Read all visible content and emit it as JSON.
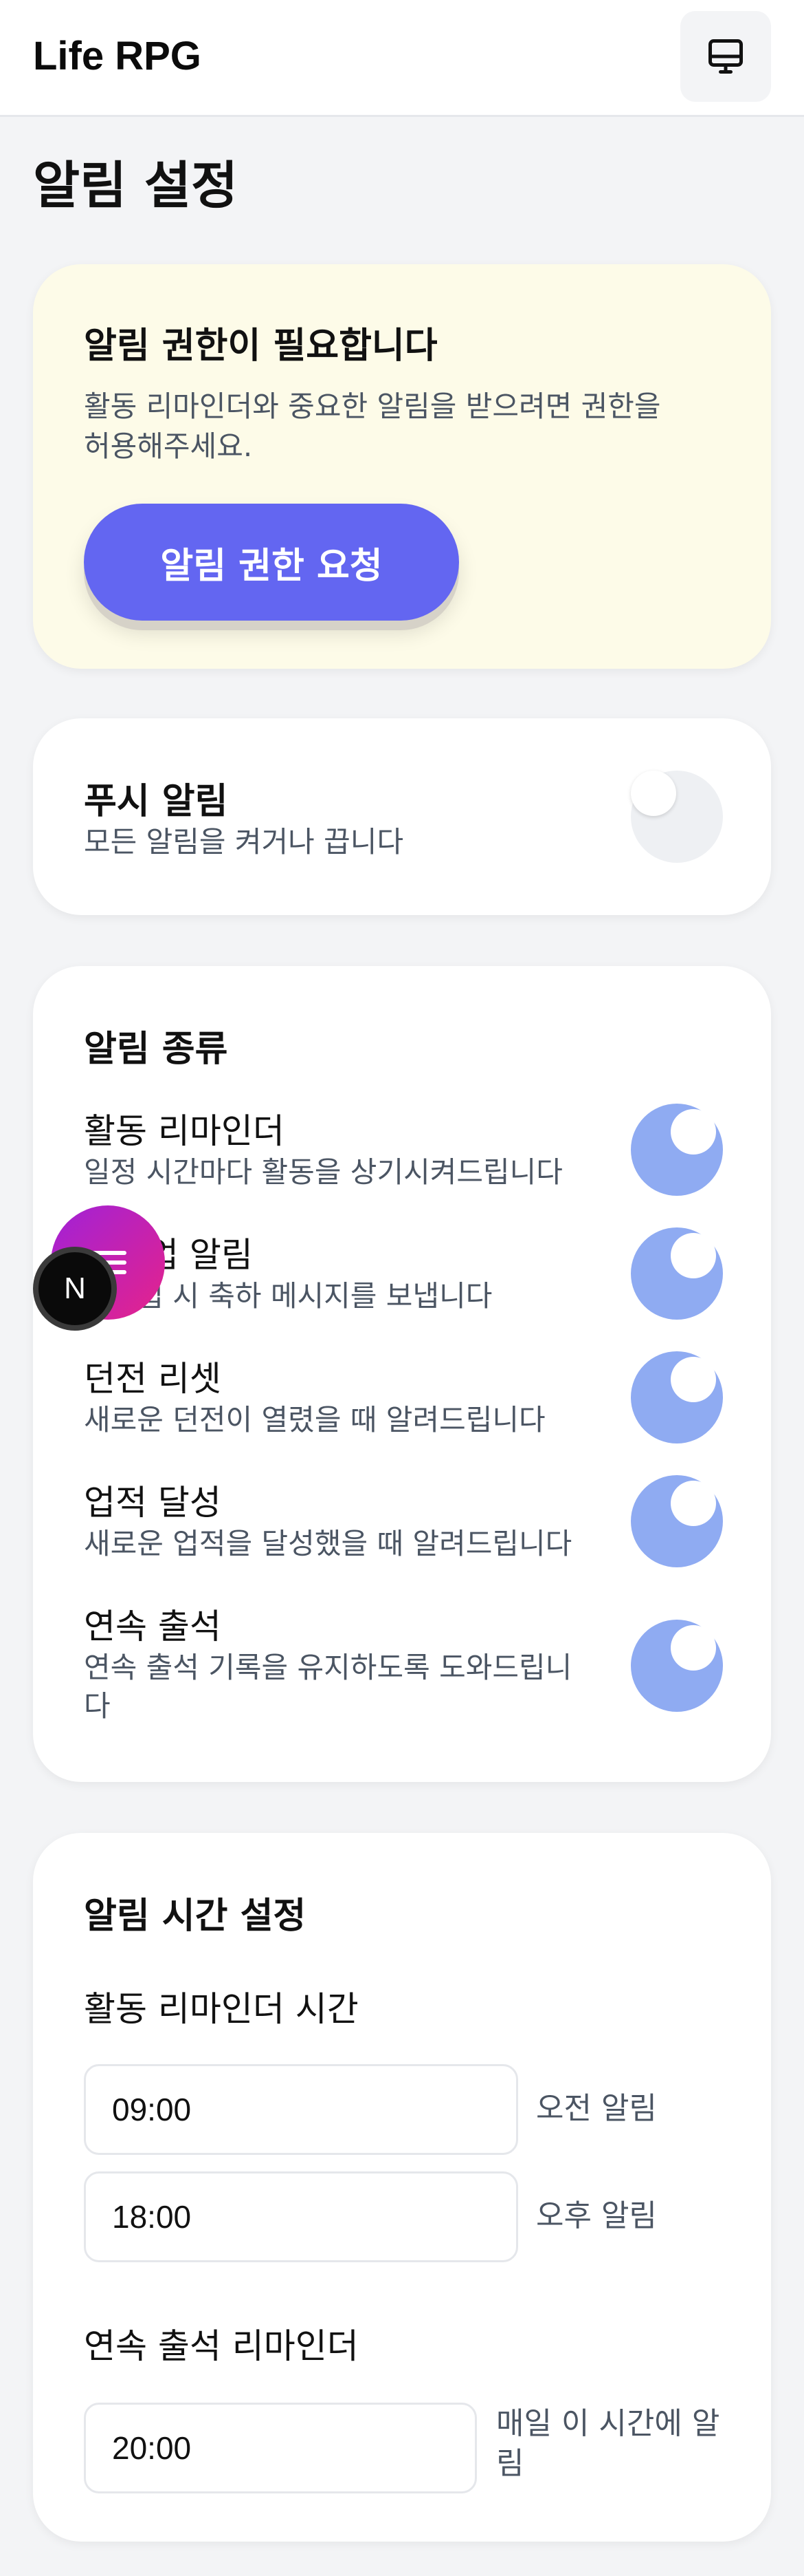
{
  "header": {
    "app_title": "Life RPG",
    "icon": "monitor-icon"
  },
  "page": {
    "title": "알림 설정"
  },
  "permission": {
    "title": "알림 권한이 필요합니다",
    "description_line1": "활동 리마인더와 중요한 알림을 받으려면 권한을",
    "description_line2": "허용해주세요.",
    "button_label": "알림 권한 요청"
  },
  "push": {
    "label": "푸시 알림",
    "sub": "모든 알림을 켜거나 끕니다",
    "enabled": false
  },
  "types": {
    "title": "알림 종류",
    "items": [
      {
        "label": "활동 리마인더",
        "sub": "일정 시간마다 활동을 상기시켜드립니다",
        "enabled": true
      },
      {
        "label": "레벨업 알림",
        "sub": "레벨업 시 축하 메시지를 보냅니다",
        "enabled": true
      },
      {
        "label": "던전 리셋",
        "sub": "새로운 던전이 열렸을 때 알려드립니다",
        "enabled": true
      },
      {
        "label": "업적 달성",
        "sub": "새로운 업적을 달성했을 때 알려드립니다",
        "enabled": true
      },
      {
        "label": "연속 출석",
        "sub_line1": "연속 출석 기록을 유지하도록 도와드립니",
        "sub_line2": "다",
        "enabled": true
      }
    ]
  },
  "time": {
    "title": "알림 시간 설정",
    "activity_label": "활동 리마인더 시간",
    "morning_value": "09:00",
    "morning_note": "오전 알림",
    "evening_value": "18:00",
    "evening_note": "오후 알림",
    "streak_label": "연속 출석 리마인더",
    "streak_value": "20:00",
    "streak_note_line1": "매일 이 시간에 알",
    "streak_note_line2": "림"
  },
  "floating": {
    "menu_icon": "hamburger-icon",
    "badge_letter": "N"
  },
  "colors": {
    "accent": "#6366f1",
    "toggle_on": "#8fabf2",
    "warning_bg": "#fdfbe8"
  }
}
